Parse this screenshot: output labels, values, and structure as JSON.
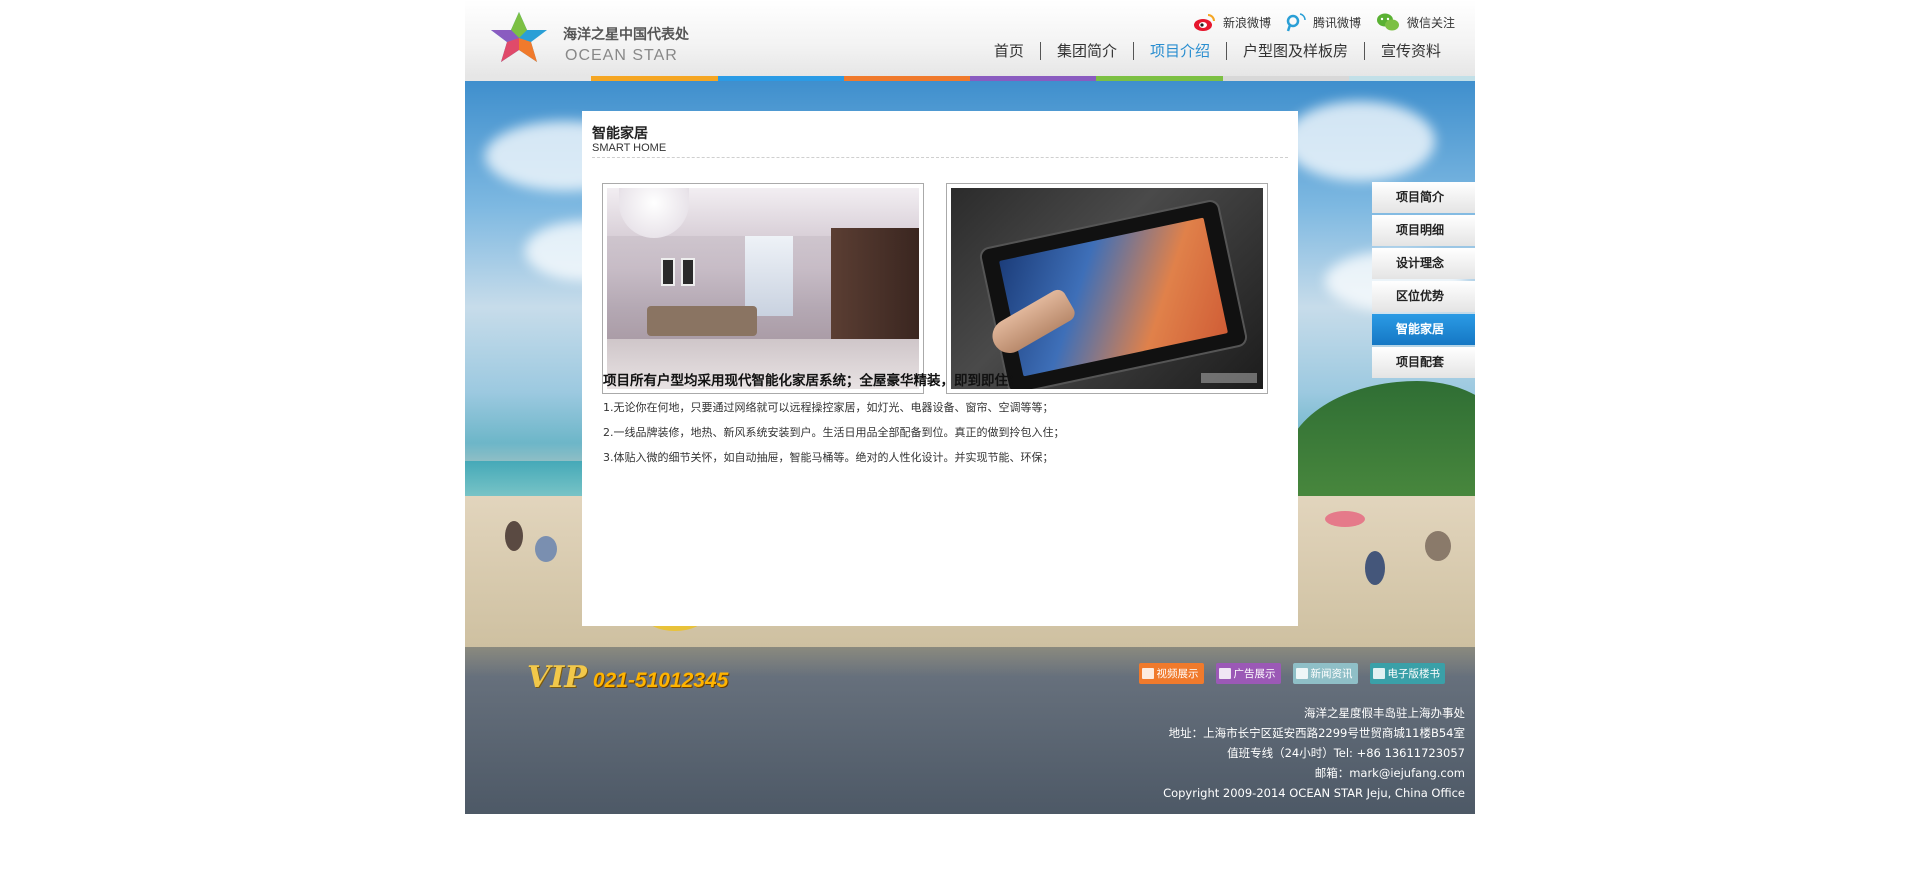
{
  "header": {
    "logo_cn": "海洋之星中国代表处",
    "logo_en": "OCEAN STAR",
    "social": [
      {
        "label": "新浪微博",
        "icon": "weibo-icon"
      },
      {
        "label": "腾讯微博",
        "icon": "tencent-weibo-icon"
      },
      {
        "label": "微信关注",
        "icon": "wechat-icon"
      }
    ],
    "nav": [
      {
        "label": "首页"
      },
      {
        "label": "集团简介"
      },
      {
        "label": "项目介绍",
        "active": true
      },
      {
        "label": "户型图及样板房"
      },
      {
        "label": "宣传资料"
      }
    ],
    "colorbar": [
      "#e6e6e6",
      "#f5a623",
      "#2b9be5",
      "#f07a2c",
      "#8a5cc0",
      "#7cc043",
      "#d8d8d8",
      "#c2e0e8"
    ]
  },
  "content": {
    "title": "智能家居",
    "subtitle": "SMART HOME",
    "images": [
      {
        "icon": "living-room-photo"
      },
      {
        "icon": "tablet-photo"
      }
    ],
    "heading": "项目所有户型均采用现代智能化家居系统；全屋豪华精装，即到即住；",
    "features": [
      "1.无论你在何地，只要通过网络就可以远程操控家居，如灯光、电器设备、窗帘、空调等等；",
      "2.一线品牌装修，地热、新风系统安装到户。生活日用品全部配备到位。真正的做到拎包入住；",
      "3.体贴入微的细节关怀，如自动抽屉，智能马桶等。绝对的人性化设计。并实现节能、环保；"
    ]
  },
  "sidemenu": [
    {
      "label": "项目简介"
    },
    {
      "label": "项目明细"
    },
    {
      "label": "设计理念"
    },
    {
      "label": "区位优势"
    },
    {
      "label": "智能家居",
      "active": true
    },
    {
      "label": "项目配套"
    }
  ],
  "footer": {
    "vip_label": "VIP",
    "vip_phone": "021-51012345",
    "quicklinks": [
      {
        "label": "视频展示",
        "color": "#f07a2c"
      },
      {
        "label": "广告展示",
        "color": "#9b59b6"
      },
      {
        "label": "新闻资讯",
        "color": "#8fbfc7"
      },
      {
        "label": "电子版楼书",
        "color": "#3aa0a8"
      }
    ],
    "info": [
      "海洋之星度假丰岛驻上海办事处",
      "地址：上海市长宁区延安西路2299号世贸商城11楼B54室",
      "值班专线（24小时）Tel: +86 13611723057",
      "邮箱：mark@iejufang.com",
      "Copyright 2009-2014 OCEAN STAR Jeju, China Office"
    ]
  }
}
